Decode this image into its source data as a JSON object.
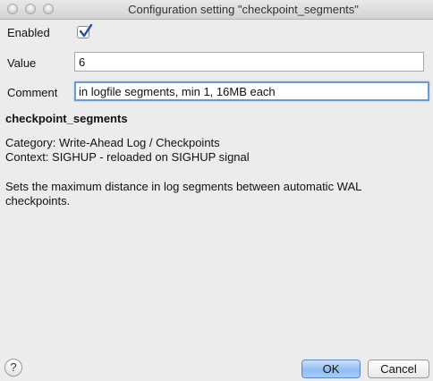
{
  "window": {
    "title": "Configuration setting \"checkpoint_segments\""
  },
  "form": {
    "enabled_label": "Enabled",
    "enabled_checked": true,
    "value_label": "Value",
    "value": "6",
    "comment_label": "Comment",
    "comment": "in logfile segments, min 1, 16MB each"
  },
  "info": {
    "name": "checkpoint_segments",
    "category": "Category: Write-Ahead Log / Checkpoints",
    "context": "Context: SIGHUP - reloaded on SIGHUP signal",
    "description_line1": "Sets the maximum distance in log segments between automatic WAL",
    "description_line2": "checkpoints."
  },
  "footer": {
    "help_label": "?",
    "ok_label": "OK",
    "cancel_label": "Cancel"
  },
  "colors": {
    "focus_ring": "#6c9ad8",
    "primary_button": "#8ebcf3",
    "checkmark": "#1f4fa0"
  }
}
